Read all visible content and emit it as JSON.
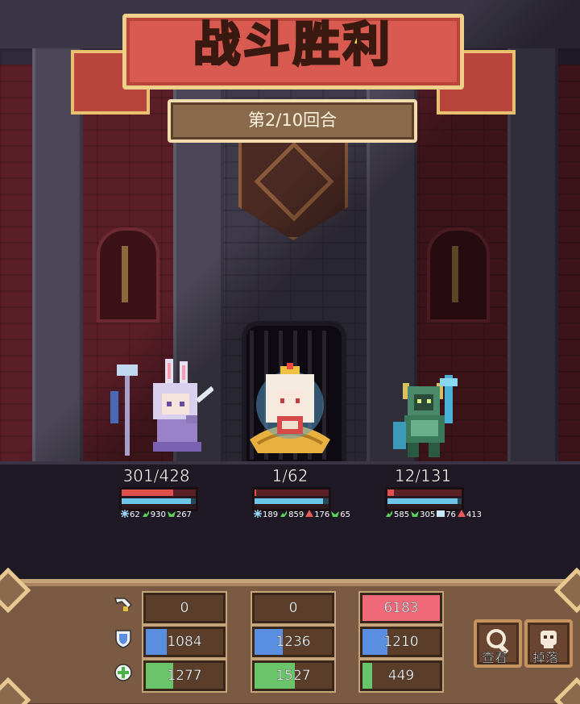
{
  "header": {
    "title": "战斗胜利",
    "round": "第2/10回合"
  },
  "heroes": [
    {
      "hp_text": "301/428",
      "hp_ratio": 0.7,
      "energy_ratio": 0.93,
      "stats": [
        "62",
        "930",
        "267"
      ],
      "stat_icons": [
        "snowflake-icon",
        "muscle-icon",
        "heal-icon"
      ]
    },
    {
      "hp_text": "1/62",
      "hp_ratio": 0.02,
      "energy_ratio": 0.92,
      "stats": [
        "189",
        "859",
        "176",
        "65"
      ],
      "stat_icons": [
        "snowflake-icon",
        "muscle-icon",
        "attack-up-icon",
        "heal-icon"
      ]
    },
    {
      "hp_text": "12/131",
      "hp_ratio": 0.09,
      "energy_ratio": 0.95,
      "stats": [
        "585",
        "305",
        "76",
        "413"
      ],
      "stat_icons": [
        "muscle-icon",
        "heal-icon",
        "shield-buff-icon",
        "attack-up-icon"
      ]
    }
  ],
  "stats_table": {
    "row_icons": [
      "sword-damage-icon",
      "shield-defense-icon",
      "heal-cross-icon"
    ],
    "rows": [
      {
        "name": "damage",
        "cells": [
          {
            "value": "0",
            "fill": 0,
            "color": "#e85a6a"
          },
          {
            "value": "0",
            "fill": 0,
            "color": "#e85a6a"
          },
          {
            "value": "6183",
            "fill": 1.0,
            "color": "#f06a7a"
          }
        ]
      },
      {
        "name": "defense",
        "cells": [
          {
            "value": "1084",
            "fill": 0.27,
            "color": "#5a8ee0"
          },
          {
            "value": "1236",
            "fill": 0.36,
            "color": "#5a8ee0"
          },
          {
            "value": "1210",
            "fill": 0.32,
            "color": "#5a8ee0"
          }
        ]
      },
      {
        "name": "heal",
        "cells": [
          {
            "value": "1277",
            "fill": 0.35,
            "color": "#6ac46a"
          },
          {
            "value": "1527",
            "fill": 0.52,
            "color": "#6ac46a"
          },
          {
            "value": "449",
            "fill": 0.12,
            "color": "#6ac46a"
          }
        ]
      }
    ]
  },
  "buttons": {
    "view_label": "查看",
    "drop_label": "掉落"
  },
  "colors": {
    "title_text": "#fff24a",
    "title_banner": "#d85a50",
    "hp_bar": "#e0504c",
    "energy_bar": "#6ec6e8"
  }
}
